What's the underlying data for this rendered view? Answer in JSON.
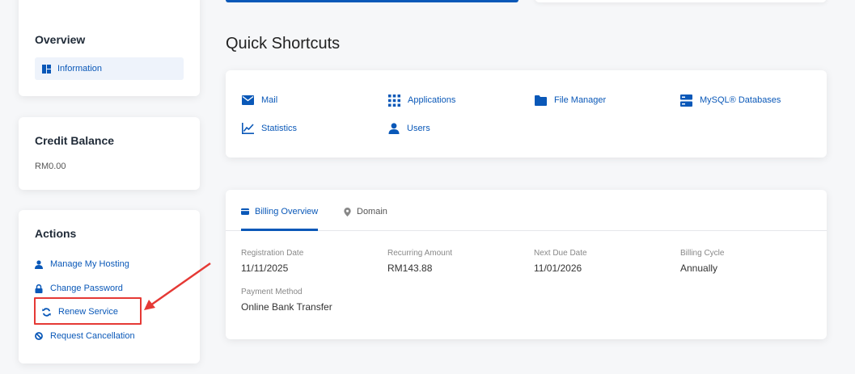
{
  "sidebar": {
    "overview": {
      "title": "Overview",
      "active_item": "Information"
    },
    "credit": {
      "title": "Credit Balance",
      "value": "RM0.00"
    },
    "actions": {
      "title": "Actions",
      "items": [
        "Manage My Hosting",
        "Change Password",
        "Renew Service",
        "Request Cancellation"
      ]
    }
  },
  "shortcuts": {
    "title": "Quick Shortcuts",
    "items": [
      "Mail",
      "Applications",
      "File Manager",
      "MySQL® Databases",
      "Statistics",
      "Users"
    ]
  },
  "billing": {
    "tabs": [
      "Billing Overview",
      "Domain"
    ],
    "fields": [
      {
        "label": "Registration Date",
        "value": "11/11/2025"
      },
      {
        "label": "Recurring Amount",
        "value": "RM143.88"
      },
      {
        "label": "Next Due Date",
        "value": "11/01/2026"
      },
      {
        "label": "Billing Cycle",
        "value": "Annually"
      },
      {
        "label": "Payment Method",
        "value": "Online Bank Transfer"
      }
    ]
  },
  "colors": {
    "accent": "#0a58b8",
    "annotation": "#e53935"
  }
}
